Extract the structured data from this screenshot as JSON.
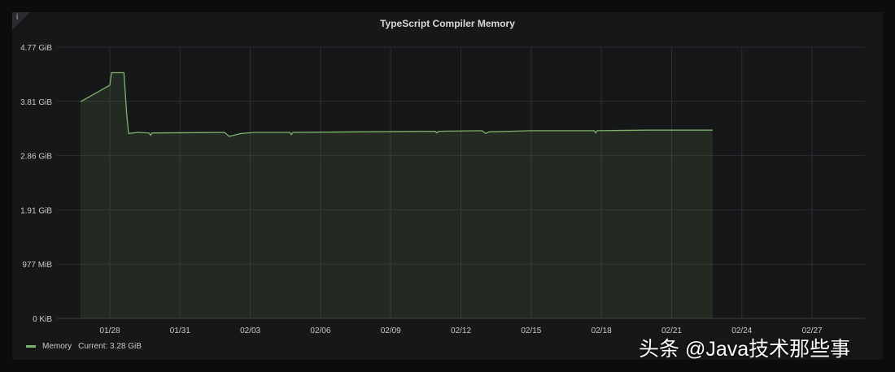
{
  "chart_data": {
    "type": "area",
    "title": "TypeScript Compiler Memory",
    "xlabel": "",
    "ylabel": "",
    "x_unit": "days since 01/28",
    "x_ticks": [
      {
        "day": 0,
        "label": "01/28"
      },
      {
        "day": 3,
        "label": "01/31"
      },
      {
        "day": 6,
        "label": "02/03"
      },
      {
        "day": 9,
        "label": "02/06"
      },
      {
        "day": 12,
        "label": "02/09"
      },
      {
        "day": 15,
        "label": "02/12"
      },
      {
        "day": 18,
        "label": "02/15"
      },
      {
        "day": 21,
        "label": "02/18"
      },
      {
        "day": 24,
        "label": "02/21"
      },
      {
        "day": 27,
        "label": "02/24"
      },
      {
        "day": 30,
        "label": "02/27"
      }
    ],
    "xlim": [
      -2.25,
      32.25
    ],
    "y_ticks": [
      {
        "value": 0,
        "label": "0 KiB"
      },
      {
        "value": 0.954,
        "label": "977 MiB"
      },
      {
        "value": 1.908,
        "label": "1.91 GiB"
      },
      {
        "value": 2.862,
        "label": "2.86 GiB"
      },
      {
        "value": 3.816,
        "label": "3.81 GiB"
      },
      {
        "value": 4.77,
        "label": "4.77 GiB"
      }
    ],
    "ylim": [
      0,
      4.77
    ],
    "grid": true,
    "series": [
      {
        "name": "Memory",
        "color": "#7eb26d",
        "points": [
          [
            -1.25,
            3.81
          ],
          [
            0,
            4.1
          ],
          [
            0.07,
            4.32
          ],
          [
            0.6,
            4.32
          ],
          [
            0.72,
            3.6
          ],
          [
            0.8,
            3.25
          ],
          [
            1.0,
            3.26
          ],
          [
            1.2,
            3.27
          ],
          [
            1.68,
            3.26
          ],
          [
            1.74,
            3.22
          ],
          [
            1.8,
            3.26
          ],
          [
            4.9,
            3.27
          ],
          [
            5.1,
            3.2
          ],
          [
            5.6,
            3.25
          ],
          [
            6.2,
            3.27
          ],
          [
            7.7,
            3.27
          ],
          [
            7.75,
            3.23
          ],
          [
            7.82,
            3.27
          ],
          [
            13.9,
            3.29
          ],
          [
            13.97,
            3.26
          ],
          [
            14.05,
            3.29
          ],
          [
            15.9,
            3.3
          ],
          [
            16.06,
            3.25
          ],
          [
            16.2,
            3.28
          ],
          [
            18,
            3.3
          ],
          [
            20.7,
            3.3
          ],
          [
            20.75,
            3.26
          ],
          [
            20.82,
            3.3
          ],
          [
            23,
            3.31
          ],
          [
            25.75,
            3.31
          ]
        ]
      }
    ]
  },
  "legend": {
    "series": "Memory",
    "current": "Current: 3.28 GiB"
  },
  "corner_glyph": "i",
  "watermark": "头条 @Java技术那些事"
}
